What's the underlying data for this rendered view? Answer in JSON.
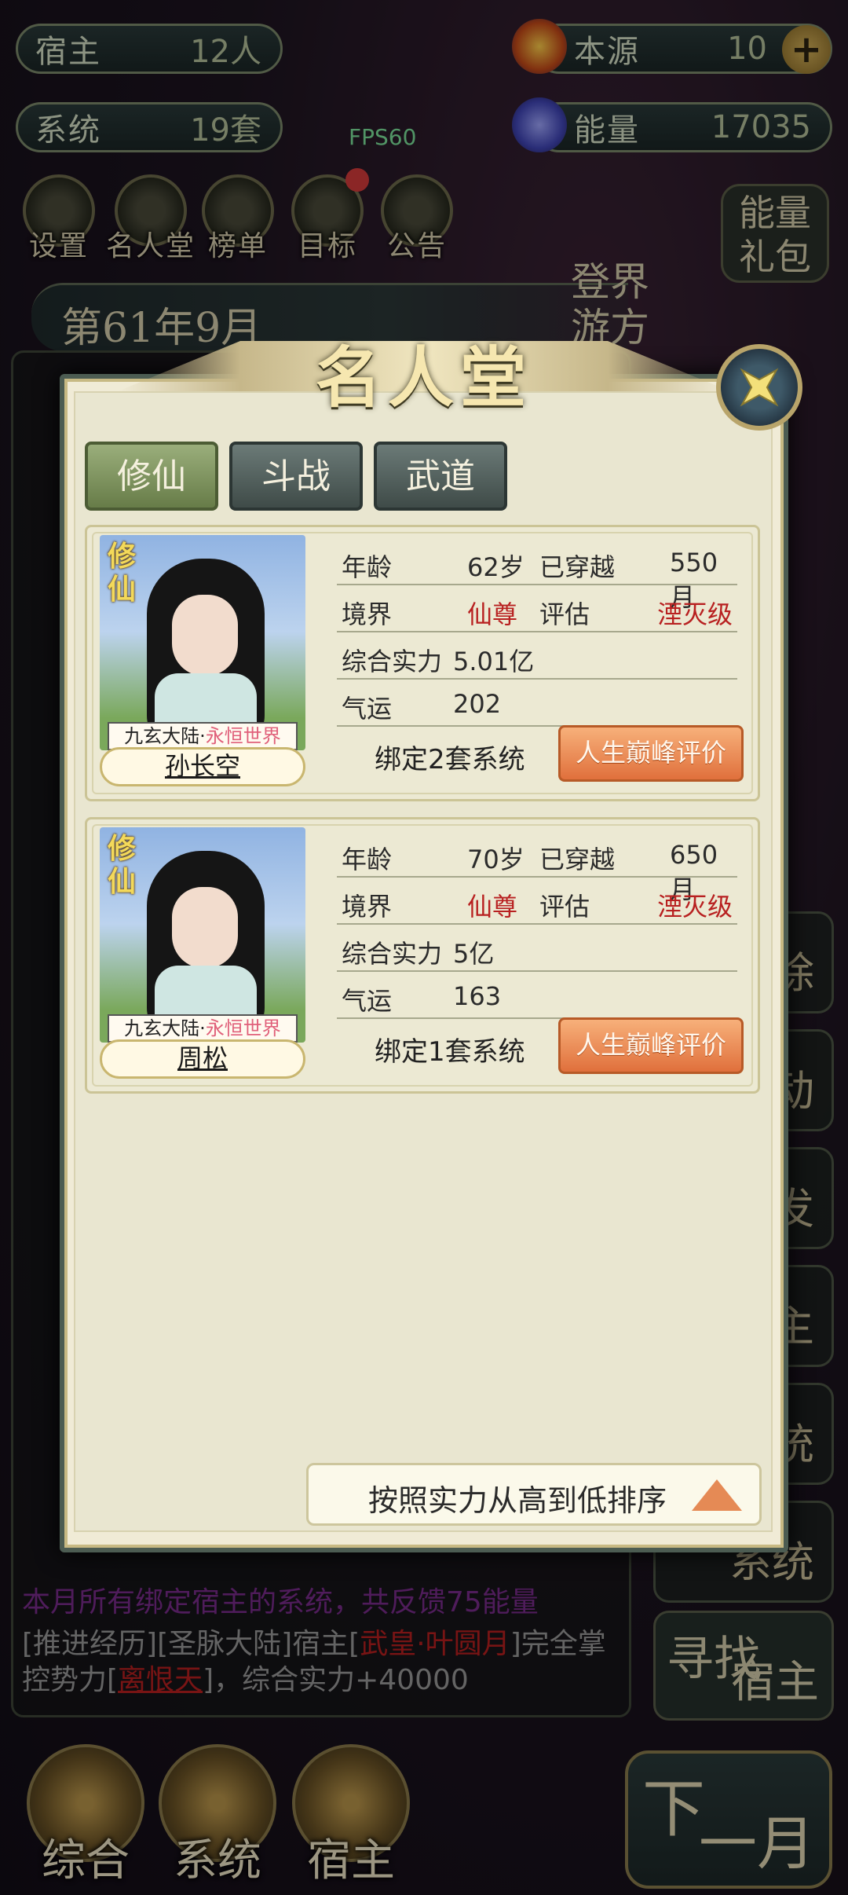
{
  "top_bar": {
    "host_label": "宿主",
    "host_value": "12人",
    "system_label": "系统",
    "system_value": "19套",
    "origin_label": "本源",
    "origin_value": "10",
    "energy_label": "能量",
    "energy_value": "17035",
    "fps": "FPS60"
  },
  "menu": {
    "items": [
      {
        "label": "设置"
      },
      {
        "label": "名人堂"
      },
      {
        "label": "榜单"
      },
      {
        "label": "目标"
      },
      {
        "label": "公告"
      }
    ],
    "energy_pack": "能量礼包"
  },
  "date": "第61年9月",
  "travel": "登界游方",
  "log": {
    "line_energy": "本月所有绑定宿主的系统，共反馈75能量",
    "line_history_a": "[推进经历][圣脉大陆]宿主[",
    "line_history_b": "武皇·叶圆月",
    "line_history_c": "]完全掌控势力[",
    "line_history_d": "离恨天",
    "line_history_e": "]，综合实力+40000"
  },
  "right_buttons": [
    "除",
    "动",
    "发",
    "主",
    "统",
    "系统"
  ],
  "seek_host": {
    "a": "寻找",
    "b": "宿主"
  },
  "bottom_nav": [
    {
      "label": "综合"
    },
    {
      "label": "系统"
    },
    {
      "label": "宿主"
    }
  ],
  "next_month": {
    "a": "下",
    "b": "一月"
  },
  "modal": {
    "title": "名人堂",
    "tabs": [
      {
        "label": "修仙",
        "active": true
      },
      {
        "label": "斗战"
      },
      {
        "label": "武道"
      }
    ],
    "sort_label": "按照实力从高到低排序",
    "cards": [
      {
        "sect": "修仙",
        "world_a": "九玄大陆·",
        "world_b": "永恒世界",
        "name": "孙长空",
        "age_label": "年龄",
        "age": "62岁",
        "traveled_label": "已穿越",
        "traveled": "550月",
        "realm_label": "境界",
        "realm": "仙尊",
        "assess_label": "评估",
        "assess": "湮灭级",
        "power_label": "综合实力",
        "power": "5.01亿",
        "luck_label": "气运",
        "luck": "202",
        "bind": "绑定2套系统",
        "eval_btn": "人生巅峰评价"
      },
      {
        "sect": "修仙",
        "world_a": "九玄大陆·",
        "world_b": "永恒世界",
        "name": "周松",
        "age_label": "年龄",
        "age": "70岁",
        "traveled_label": "已穿越",
        "traveled": "650月",
        "realm_label": "境界",
        "realm": "仙尊",
        "assess_label": "评估",
        "assess": "湮灭级",
        "power_label": "综合实力",
        "power": "5亿",
        "luck_label": "气运",
        "luck": "163",
        "bind": "绑定1套系统",
        "eval_btn": "人生巅峰评价"
      }
    ]
  }
}
